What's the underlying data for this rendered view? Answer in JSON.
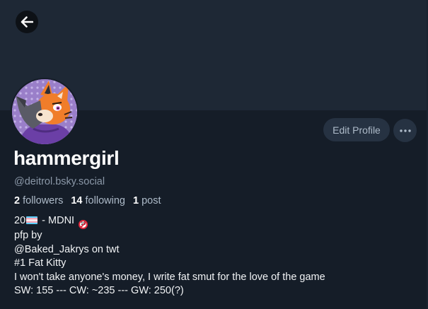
{
  "header": {
    "back_icon": "arrow-left-icon"
  },
  "profile": {
    "display_name": "hammergirl",
    "handle": "@deitrol.bsky.social",
    "edit_profile_label": "Edit Profile",
    "more_icon": "ellipsis-icon",
    "avatar_description": "avatar",
    "stats": {
      "followers_count": "2",
      "followers_label": "followers",
      "following_count": "14",
      "following_label": "following",
      "posts_count": "1",
      "posts_label": "post"
    },
    "bio": {
      "line1_prefix": "20",
      "line1_flag": "transgender-flag-emoji",
      "line1_text": " - MDNI ",
      "line1_badge": "no-under-18-emoji",
      "line1_badge_text": "18",
      "line2": "pfp by",
      "line3": "@Baked_Jakrys on twt",
      "line4": "#1 Fat Kitty",
      "line5": "I won't take anyone's money, I write fat smut for the love of the game",
      "line6": "SW: 155 --- CW: ~235 --- GW: 250(?)"
    }
  },
  "colors": {
    "background": "#151d28",
    "banner": "#1e2835",
    "button_bg": "#263242",
    "text_primary": "#ffffff",
    "text_secondary": "#8b98a8"
  }
}
